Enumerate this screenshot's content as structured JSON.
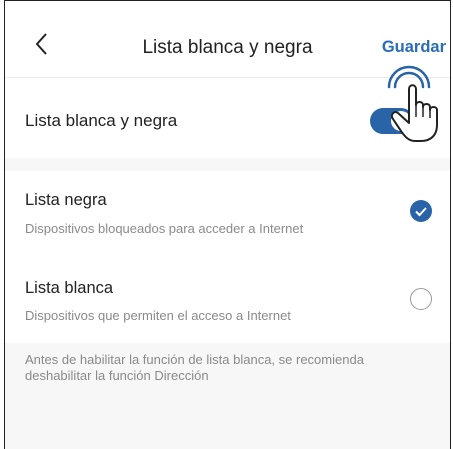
{
  "header": {
    "title": "Lista blanca y negra",
    "save_label": "Guardar"
  },
  "toggle_row": {
    "label": "Lista blanca y negra",
    "enabled": true
  },
  "options": [
    {
      "name": "Lista negra",
      "description": "Dispositivos bloqueados para acceder a Internet",
      "selected": true
    },
    {
      "name": "Lista blanca",
      "description": "Dispositivos que permiten el acceso a Internet",
      "selected": false
    }
  ],
  "note": "Antes de habilitar la función de lista blanca, se recomienda deshabilitar la función Dirección",
  "colors": {
    "accent": "#2a64a8",
    "save_text": "#2a6db6",
    "background": "#f7f7f8"
  },
  "icons": {
    "back": "chevron-left-icon",
    "pointer": "hand-pointer-icon",
    "selected": "checkmark-circle-icon",
    "unselected": "empty-radio-icon"
  }
}
